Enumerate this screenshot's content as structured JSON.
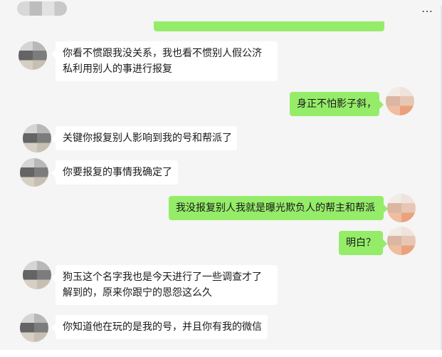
{
  "window": {
    "more_icon": "…"
  },
  "messages": [
    {
      "side": "in",
      "text": "你看不惯跟我没关系，我也看不惯别人假公济私利用别人的事进行报复"
    },
    {
      "side": "out",
      "text": "身正不怕影子斜，"
    },
    {
      "side": "in",
      "text": "关键你报复别人影响到我的号和帮派了"
    },
    {
      "side": "in",
      "text": "你要报复的事情我确定了"
    },
    {
      "side": "out",
      "text": "我没报复别人我就是曝光欺负人的帮主和帮派"
    },
    {
      "side": "out",
      "text": "明白？"
    },
    {
      "side": "in",
      "text": "狗玉这个名字我也是今天进行了一些调查才了解到的，原来你跟宁的恩怨这么久"
    },
    {
      "side": "in",
      "text": "你知道他在玩的是我的号，并且你有我的微信"
    }
  ],
  "colors": {
    "incoming_bubble": "#ffffff",
    "outgoing_bubble": "#95ec69",
    "background": "#f5f5f5"
  }
}
